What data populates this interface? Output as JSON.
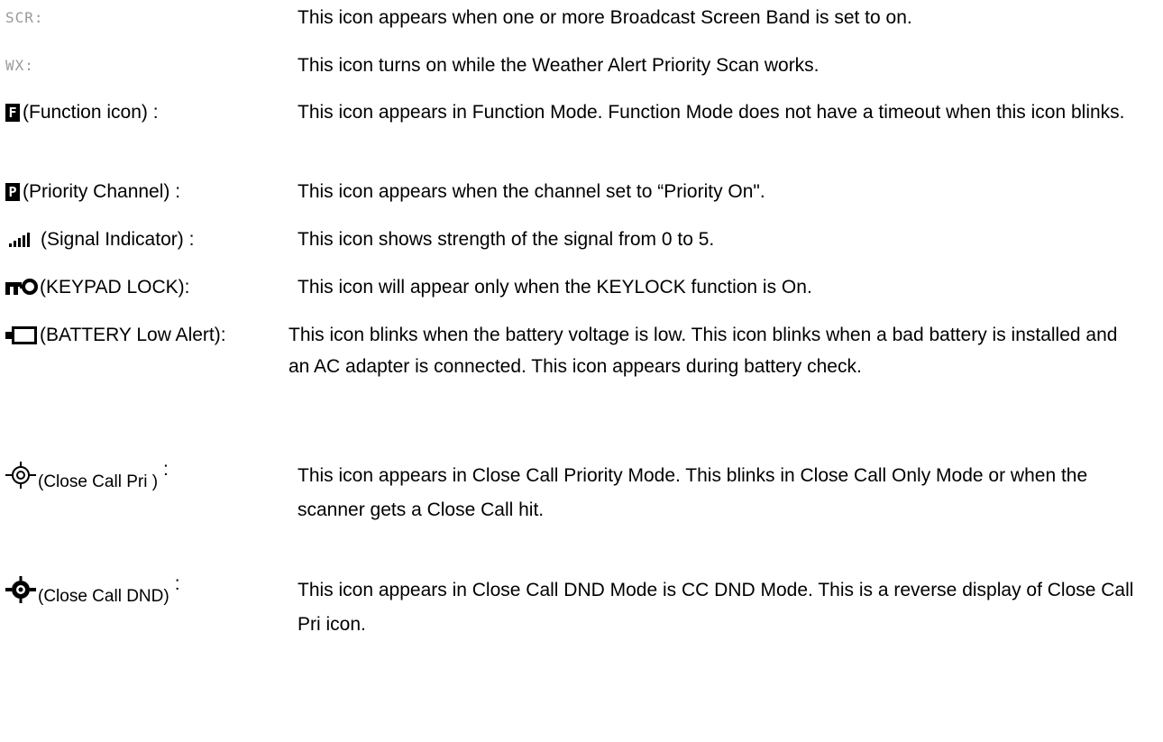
{
  "items": [
    {
      "term": "SCR:",
      "description": "This icon appears when one or more Broadcast Screen Band is set to on."
    },
    {
      "term": "WX:",
      "description": "This icon turns on while the Weather Alert Priority Scan works."
    },
    {
      "icon_letter": "F",
      "term": "(Function icon) :",
      "description": "This icon appears in Function Mode. Function Mode does not have a timeout when this icon blinks."
    },
    {
      "icon_letter": "P",
      "term": "(Priority Channel) :",
      "description": "This icon appears when the channel set to “Priority On\"."
    },
    {
      "icon": "signal-bars-icon",
      "term": "(Signal Indicator) :",
      "description": "This icon shows strength of the signal from 0 to 5."
    },
    {
      "icon": "key-lock-icon",
      "term": "(KEYPAD LOCK):",
      "description": "This icon will appear only when the KEYLOCK function is On."
    },
    {
      "icon": "battery-low-icon",
      "term": "(BATTERY Low Alert):",
      "description": "This icon blinks when the battery voltage is low. This icon blinks when a bad battery is installed and an AC adapter is connected. This icon appears during battery check."
    },
    {
      "icon": "close-call-icon",
      "term": "(Close Call Pri )",
      "colon": ":",
      "description": "This icon appears in Close Call Priority Mode. This blinks in Close Call Only Mode or when the scanner gets a Close Call hit."
    },
    {
      "icon": "close-call-dnd-icon",
      "term": "(Close Call DND)",
      "colon": ":",
      "description": "This icon appears in Close Call DND Mode is CC DND Mode. This is a reverse display of Close Call Pri icon."
    }
  ]
}
